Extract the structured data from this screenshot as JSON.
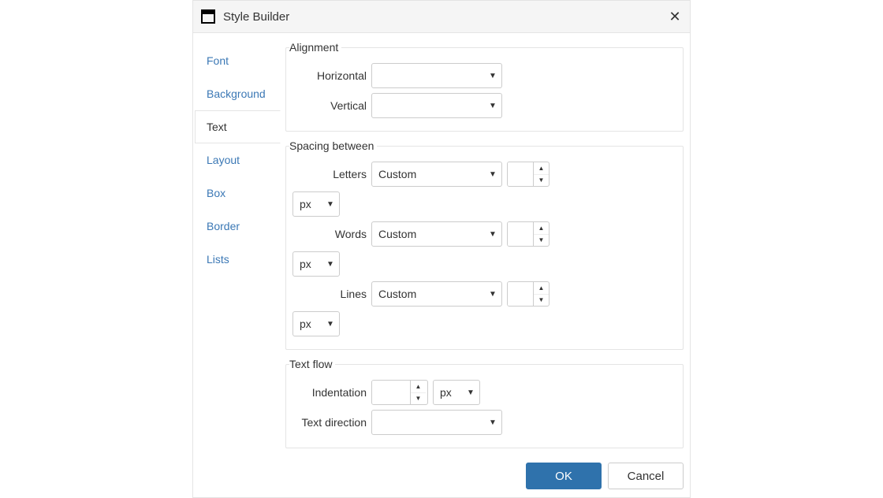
{
  "dialog": {
    "title": "Style Builder"
  },
  "nav": {
    "items": [
      {
        "label": "Font",
        "active": false
      },
      {
        "label": "Background",
        "active": false
      },
      {
        "label": "Text",
        "active": true
      },
      {
        "label": "Layout",
        "active": false
      },
      {
        "label": "Box",
        "active": false
      },
      {
        "label": "Border",
        "active": false
      },
      {
        "label": "Lists",
        "active": false
      }
    ]
  },
  "groups": {
    "alignment": {
      "legend": "Alignment",
      "horizontal": {
        "label": "Horizontal",
        "value": ""
      },
      "vertical": {
        "label": "Vertical",
        "value": ""
      }
    },
    "spacing": {
      "legend": "Spacing between",
      "letters": {
        "label": "Letters",
        "mode": "Custom",
        "value": "",
        "unit": "px"
      },
      "words": {
        "label": "Words",
        "mode": "Custom",
        "value": "",
        "unit": "px"
      },
      "lines": {
        "label": "Lines",
        "mode": "Custom",
        "value": "",
        "unit": "px"
      }
    },
    "textflow": {
      "legend": "Text flow",
      "indentation": {
        "label": "Indentation",
        "value": "",
        "unit": "px"
      },
      "direction": {
        "label": "Text direction",
        "value": ""
      }
    }
  },
  "footer": {
    "ok": "OK",
    "cancel": "Cancel"
  }
}
